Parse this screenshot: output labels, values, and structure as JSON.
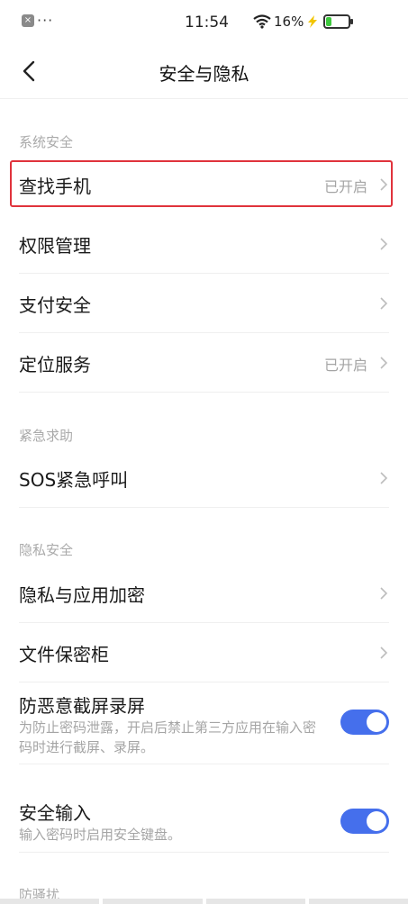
{
  "status_bar": {
    "time": "11:54",
    "battery": "16%",
    "notif_icon": "x-icon",
    "dots": "···"
  },
  "header": {
    "title": "安全与隐私",
    "back_icon": "back-chevron-icon"
  },
  "sections": {
    "system": "系统安全",
    "emergency": "紧急求助",
    "privacy": "隐私安全",
    "harass": "防骚扰"
  },
  "items": {
    "find_phone": {
      "label": "查找手机",
      "status": "已开启"
    },
    "permissions": {
      "label": "权限管理"
    },
    "payment": {
      "label": "支付安全"
    },
    "location": {
      "label": "定位服务",
      "status": "已开启"
    },
    "sos": {
      "label": "SOS紧急呼叫"
    },
    "app_encrypt": {
      "label": "隐私与应用加密"
    },
    "file_safe": {
      "label": "文件保密柜"
    },
    "anti_screenshot": {
      "label": "防恶意截屏录屏",
      "desc": "为防止密码泄露，开启后禁止第三方应用在输入密码时进行截屏、录屏。",
      "enabled": true
    },
    "secure_input": {
      "label": "安全输入",
      "desc": "输入密码时启用安全键盘。",
      "enabled": true
    }
  },
  "colors": {
    "accent": "#456fec",
    "highlight": "#e0333c",
    "battery_fill": "#3ec93e",
    "charging": "#f2c500"
  }
}
